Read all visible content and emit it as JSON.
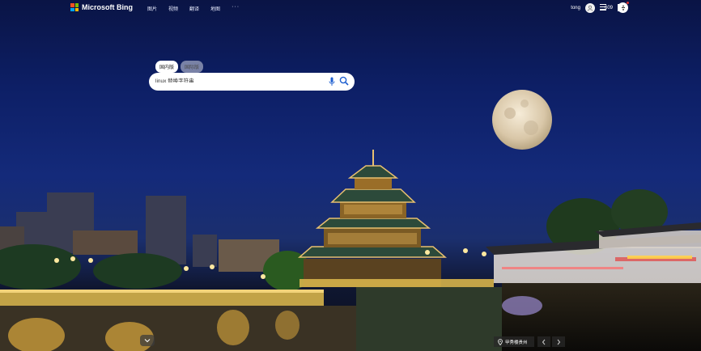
{
  "brand": {
    "name": "Microsoft Bing",
    "logo_colors": [
      "#f25022",
      "#7fba00",
      "#00a4ef",
      "#ffb900"
    ]
  },
  "nav": {
    "items": [
      "图片",
      "视频",
      "翻译",
      "地图"
    ],
    "more": "···"
  },
  "account": {
    "username": "tong",
    "points": "609"
  },
  "search": {
    "tabs": [
      {
        "label": "国内版",
        "active": true
      },
      {
        "label": "国际版",
        "active": false
      }
    ],
    "query": "linux 替换字符串"
  },
  "background": {
    "location_label": "甲秀楼贵州"
  },
  "icons": [
    "microsoft-logo-icon",
    "user-avatar-icon",
    "rewards-trophy-icon",
    "hamburger-menu-icon",
    "qr-code-icon",
    "microphone-icon",
    "search-icon",
    "chevron-down-icon",
    "location-pin-icon",
    "chevron-left-icon",
    "chevron-right-icon"
  ]
}
